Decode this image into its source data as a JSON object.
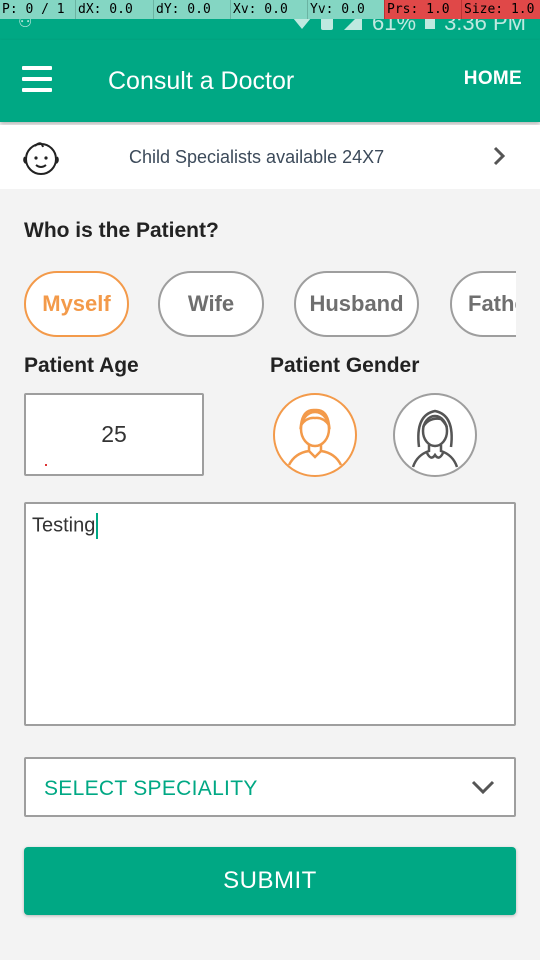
{
  "debug_bar": {
    "p": "P: 0 / 1",
    "dx": "dX: 0.0",
    "dy": "dY: 0.0",
    "xv": "Xv: 0.0",
    "yv": "Yv: 0.0",
    "prs": "Prs: 1.0",
    "size": "Size: 1.0"
  },
  "status_bar": {
    "battery": "61%",
    "time": "3:36 PM"
  },
  "app_bar": {
    "title": "Consult a Doctor",
    "home_label": "HOME"
  },
  "banner": {
    "text": "Child Specialists available 24X7",
    "icon": "baby-face-icon"
  },
  "patient_section": {
    "title": "Who is the Patient?",
    "options": [
      {
        "label": "Myself",
        "selected": true
      },
      {
        "label": "Wife",
        "selected": false
      },
      {
        "label": "Husband",
        "selected": false
      },
      {
        "label": "Father",
        "selected": false
      }
    ]
  },
  "age": {
    "title": "Patient Age",
    "value": "25"
  },
  "gender": {
    "title": "Patient Gender",
    "options": [
      {
        "icon": "male-avatar-icon",
        "selected": true
      },
      {
        "icon": "female-avatar-icon",
        "selected": false
      }
    ]
  },
  "notes": {
    "value": "Testing"
  },
  "speciality": {
    "label": "SELECT SPECIALITY"
  },
  "submit": {
    "label": "SUBMIT"
  },
  "colors": {
    "primary": "#00a884",
    "accent": "#f39a4a",
    "border": "#9e9e9e"
  }
}
